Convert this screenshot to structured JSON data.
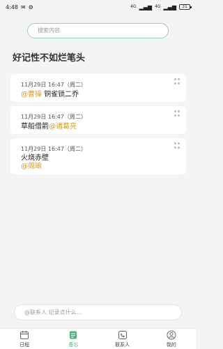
{
  "status_bar": {
    "time": "4:48",
    "net1": "4G",
    "net2": "4G",
    "battery": "31"
  },
  "search": {
    "placeholder": "搜索内容"
  },
  "page_title": "好记性不如烂笔头",
  "notes": [
    {
      "time": "11月29日 16:47（周二）",
      "mention": "@曹操",
      "text": " 铜雀锁二乔",
      "order": "mention-first"
    },
    {
      "time": "11月29日 16:47（周二）",
      "text": "草船借箭",
      "mention": "@诸葛亮",
      "order": "text-first"
    },
    {
      "time": "11月29日 16:47（周二）",
      "text": "火烧赤壁",
      "mention": "@周瑜",
      "order": "stacked"
    }
  ],
  "composer": {
    "placeholder": "@联系人 记录点什么..."
  },
  "tabs": [
    {
      "label": "日程",
      "icon": "calendar-icon",
      "active": false
    },
    {
      "label": "备忘",
      "icon": "memo-icon",
      "active": true
    },
    {
      "label": "联系人",
      "icon": "phone-icon",
      "active": false
    },
    {
      "label": "我的",
      "icon": "profile-icon",
      "active": false
    }
  ],
  "colors": {
    "accent": "#46b97d",
    "mention": "#d99b2b",
    "search_border": "#8fd3b5"
  }
}
